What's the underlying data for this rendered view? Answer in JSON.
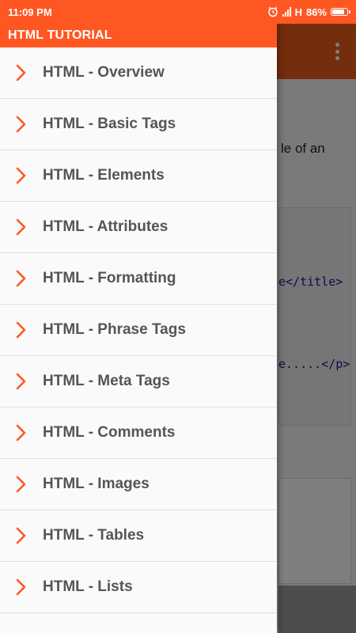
{
  "status_bar": {
    "time": "11:09 PM",
    "network": "H",
    "battery_text": "86%",
    "battery_level": 0.86
  },
  "drawer": {
    "title": "HTML TUTORIAL",
    "items": [
      {
        "label": "HTML - Overview"
      },
      {
        "label": "HTML - Basic Tags"
      },
      {
        "label": "HTML - Elements"
      },
      {
        "label": "HTML - Attributes"
      },
      {
        "label": "HTML - Formatting"
      },
      {
        "label": "HTML - Phrase Tags"
      },
      {
        "label": "HTML - Meta Tags"
      },
      {
        "label": "HTML - Comments"
      },
      {
        "label": "HTML - Images"
      },
      {
        "label": "HTML - Tables"
      },
      {
        "label": "HTML - Lists"
      }
    ]
  },
  "background": {
    "text_fragment": "le of an",
    "code_line_1": "e</title>",
    "code_line_2": "e.....</p>"
  },
  "colors": {
    "accent": "#ff5722",
    "chevron": "#ff5722",
    "item_text": "#555555"
  }
}
